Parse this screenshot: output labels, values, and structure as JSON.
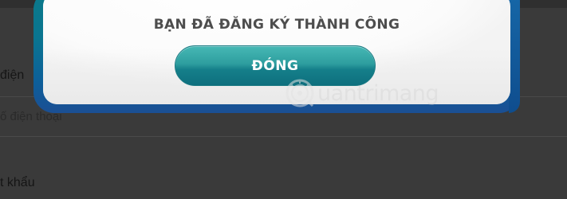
{
  "background_form": {
    "label_phone": "điện",
    "phone_placeholder": "ố điện thoại",
    "label_password": "t khẩu"
  },
  "dialog": {
    "title": "BẠN ĐÃ ĐĂNG KÝ THÀNH CÔNG",
    "close_label": "ĐÓNG"
  },
  "watermark": {
    "brand_rest": "uantrimang",
    "icon": "quantrimang-logo"
  },
  "colors": {
    "dialog_frame": "#0b7a8a",
    "button_teal": "#2e9e9f",
    "overlay": "#3a3a3a"
  }
}
